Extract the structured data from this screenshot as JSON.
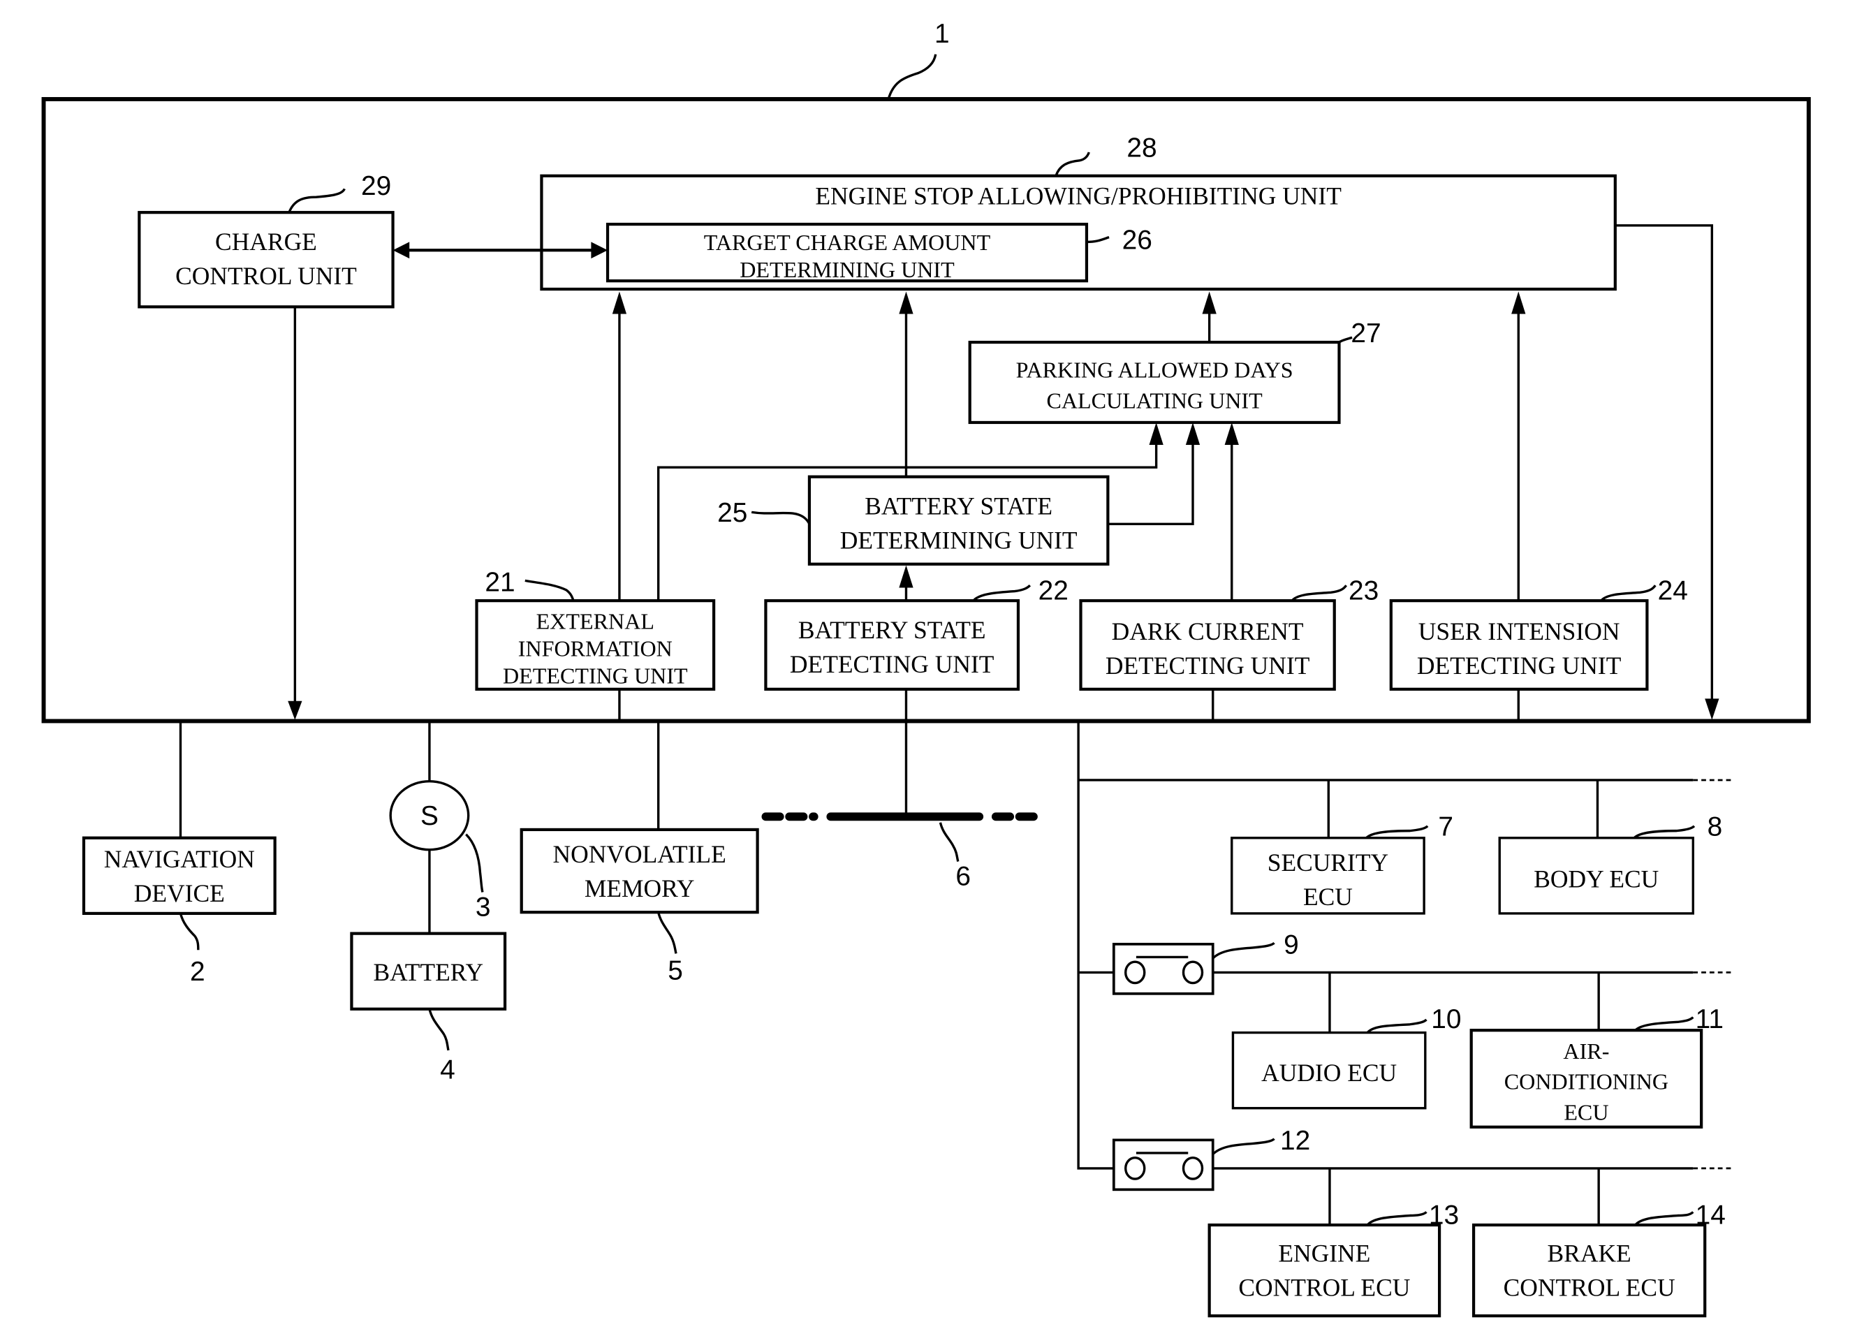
{
  "figure": {
    "system_ref": "1",
    "blocks": {
      "engine_stop": {
        "ref": "28",
        "lines": [
          "ENGINE STOP ALLOWING/PROHIBITING UNIT"
        ]
      },
      "target_charge": {
        "ref": "26",
        "lines": [
          "TARGET CHARGE AMOUNT",
          "DETERMINING UNIT"
        ]
      },
      "charge_control": {
        "ref": "29",
        "lines": [
          "CHARGE",
          "CONTROL UNIT"
        ]
      },
      "parking_days": {
        "ref": "27",
        "lines": [
          "PARKING ALLOWED DAYS",
          "CALCULATING UNIT"
        ]
      },
      "battery_state_det": {
        "ref": "25",
        "lines": [
          "BATTERY STATE",
          "DETERMINING UNIT"
        ]
      },
      "external_info": {
        "ref": "21",
        "lines": [
          "EXTERNAL",
          "INFORMATION",
          "DETECTING UNIT"
        ]
      },
      "battery_state_detect": {
        "ref": "22",
        "lines": [
          "BATTERY STATE",
          "DETECTING UNIT"
        ]
      },
      "dark_current": {
        "ref": "23",
        "lines": [
          "DARK CURRENT",
          "DETECTING UNIT"
        ]
      },
      "user_intension": {
        "ref": "24",
        "lines": [
          "USER INTENSION",
          "DETECTING UNIT"
        ]
      },
      "navigation": {
        "ref": "2",
        "lines": [
          "NAVIGATION",
          "DEVICE"
        ]
      },
      "battery": {
        "ref": "4",
        "lines": [
          "BATTERY"
        ]
      },
      "nonvolatile_memory": {
        "ref": "5",
        "lines": [
          "NONVOLATILE",
          "MEMORY"
        ]
      },
      "security_ecu": {
        "ref": "7",
        "lines": [
          "SECURITY",
          "ECU"
        ]
      },
      "body_ecu": {
        "ref": "8",
        "lines": [
          "BODY ECU"
        ]
      },
      "audio_ecu": {
        "ref": "10",
        "lines": [
          "AUDIO ECU"
        ]
      },
      "aircon_ecu": {
        "ref": "11",
        "lines": [
          "AIR-",
          "CONDITIONING",
          "ECU"
        ]
      },
      "engine_ecu": {
        "ref": "13",
        "lines": [
          "ENGINE",
          "CONTROL ECU"
        ]
      },
      "brake_ecu": {
        "ref": "14",
        "lines": [
          "BRAKE",
          "CONTROL ECU"
        ]
      }
    },
    "switch": {
      "ref": "3",
      "symbol": "S"
    },
    "bus": {
      "ref": "6"
    },
    "gateways": [
      {
        "ref": "9"
      },
      {
        "ref": "12"
      }
    ]
  }
}
